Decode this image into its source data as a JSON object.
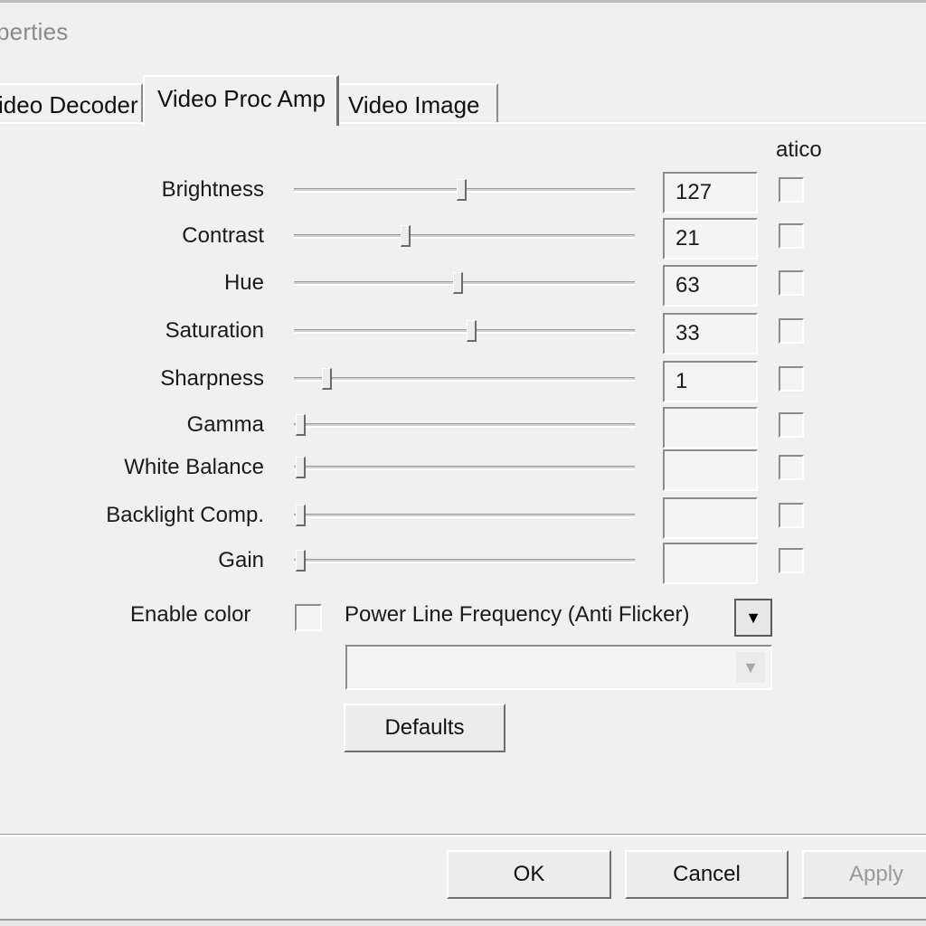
{
  "window": {
    "title": "perties"
  },
  "tabs": [
    {
      "label": "ideo Decoder",
      "active": false
    },
    {
      "label": "Video Proc Amp",
      "active": true
    },
    {
      "label": "Video Image",
      "active": false
    }
  ],
  "auto_header": "atico",
  "rows": [
    {
      "label": "Brightness",
      "value": "127",
      "level": 0.49,
      "auto": false
    },
    {
      "label": "Contrast",
      "value": "21",
      "level": 0.32,
      "auto": false
    },
    {
      "label": "Hue",
      "value": "63",
      "level": 0.48,
      "auto": false
    },
    {
      "label": "Saturation",
      "value": "33",
      "level": 0.52,
      "auto": false
    },
    {
      "label": "Sharpness",
      "value": "1",
      "level": 0.08,
      "auto": false
    },
    {
      "label": "Gamma",
      "value": "",
      "level": 0.0,
      "auto": false
    },
    {
      "label": "White Balance",
      "value": "",
      "level": 0.0,
      "auto": false
    },
    {
      "label": "Backlight Comp.",
      "value": "",
      "level": 0.0,
      "auto": false
    },
    {
      "label": "Gain",
      "value": "",
      "level": 0.0,
      "auto": false
    }
  ],
  "enable_color": {
    "label": "Enable color",
    "checked": false
  },
  "power_line": {
    "label": "Power Line Frequency (Anti Flicker)",
    "selected": ""
  },
  "buttons": {
    "defaults": "Defaults",
    "ok": "OK",
    "cancel": "Cancel",
    "apply": "Apply"
  }
}
